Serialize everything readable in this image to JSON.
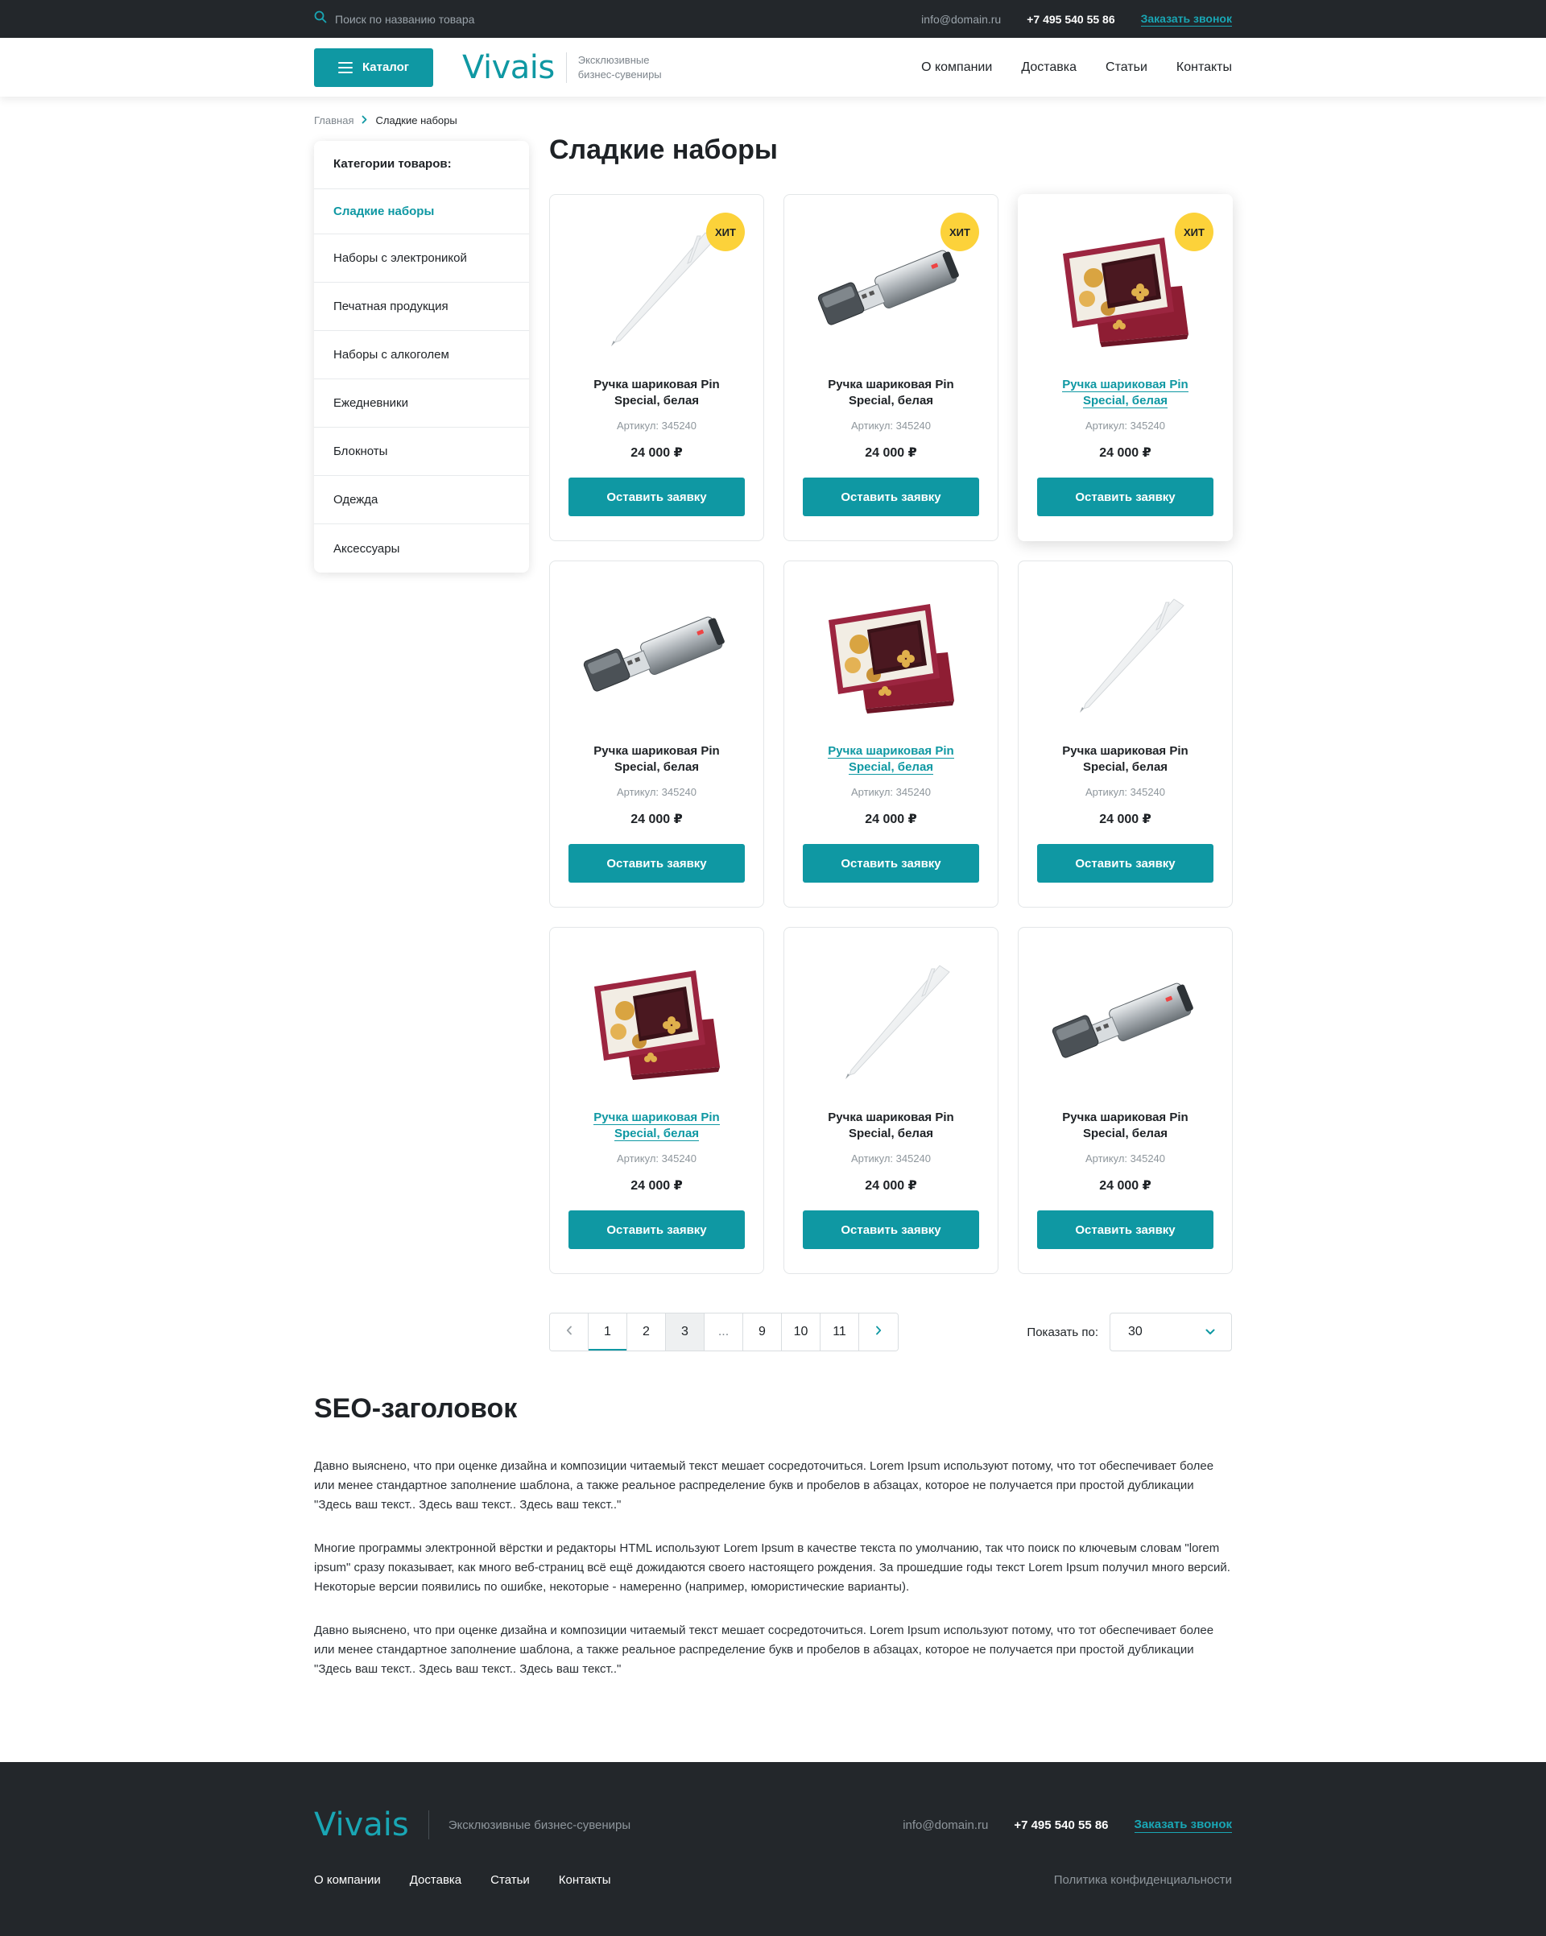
{
  "topbar": {
    "search_placeholder": "Поиск по названию товара",
    "email": "info@domain.ru",
    "phone": "+7 495 540 55 86",
    "callback": "Заказать звонок"
  },
  "header": {
    "catalog_label": "Каталог",
    "logo": "Vivais",
    "tagline": "Эксклюзивные бизнес-сувениры",
    "nav": [
      "О компании",
      "Доставка",
      "Статьи",
      "Контакты"
    ]
  },
  "breadcrumb": {
    "home": "Главная",
    "current": "Сладкие наборы"
  },
  "sidebar": {
    "title": "Категории товаров:",
    "items": [
      "Сладкие наборы",
      "Наборы с электроникой",
      "Печатная продукция",
      "Наборы с алкоголем",
      "Ежедневники",
      "Блокноты",
      "Одежда",
      "Аксессуары"
    ]
  },
  "page_title": "Сладкие наборы",
  "products": [
    {
      "image": "pen",
      "badge": "ХИТ",
      "name": "Ручка шариковая Pin Special, белая",
      "sku": "Артикул: 345240",
      "price": "24 000 ₽",
      "button": "Оставить заявку",
      "link": false,
      "hover": false
    },
    {
      "image": "usb",
      "badge": "ХИТ",
      "name": "Ручка шариковая Pin Special, белая",
      "sku": "Артикул: 345240",
      "price": "24 000 ₽",
      "button": "Оставить заявку",
      "link": false,
      "hover": false
    },
    {
      "image": "giftbox",
      "badge": "ХИТ",
      "name": "Ручка шариковая Pin Special, белая",
      "sku": "Артикул: 345240",
      "price": "24 000 ₽",
      "button": "Оставить заявку",
      "link": true,
      "hover": true
    },
    {
      "image": "usb",
      "badge": "",
      "name": "Ручка шариковая Pin Special, белая",
      "sku": "Артикул: 345240",
      "price": "24 000 ₽",
      "button": "Оставить заявку",
      "link": false,
      "hover": false
    },
    {
      "image": "giftbox",
      "badge": "",
      "name": "Ручка шариковая Pin Special, белая",
      "sku": "Артикул: 345240",
      "price": "24 000 ₽",
      "button": "Оставить заявку",
      "link": true,
      "hover": false
    },
    {
      "image": "pen",
      "badge": "",
      "name": "Ручка шариковая Pin Special, белая",
      "sku": "Артикул: 345240",
      "price": "24 000 ₽",
      "button": "Оставить заявку",
      "link": false,
      "hover": false
    },
    {
      "image": "giftbox",
      "badge": "",
      "name": "Ручка шариковая Pin Special, белая",
      "sku": "Артикул: 345240",
      "price": "24 000 ₽",
      "button": "Оставить заявку",
      "link": true,
      "hover": false
    },
    {
      "image": "pen",
      "badge": "",
      "name": "Ручка шариковая Pin Special, белая",
      "sku": "Артикул: 345240",
      "price": "24 000 ₽",
      "button": "Оставить заявку",
      "link": false,
      "hover": false
    },
    {
      "image": "usb",
      "badge": "",
      "name": "Ручка шариковая Pin Special, белая",
      "sku": "Артикул: 345240",
      "price": "24 000 ₽",
      "button": "Оставить заявку",
      "link": false,
      "hover": false
    }
  ],
  "pagination": {
    "pages": [
      "1",
      "2",
      "3",
      "...",
      "9",
      "10",
      "11"
    ],
    "active": "1",
    "current": "3",
    "per_page_label": "Показать по:",
    "per_page_value": "30"
  },
  "seo": {
    "title": "SEO-заголовок",
    "paragraphs": [
      "Давно выяснено, что при оценке дизайна и композиции читаемый текст мешает сосредоточиться. Lorem Ipsum используют потому, что тот обеспечивает более или менее стандартное заполнение шаблона, а также реальное распределение букв и пробелов в абзацах, которое не получается при простой дубликации \"Здесь ваш текст.. Здесь ваш текст.. Здесь ваш текст..\"",
      "Многие программы электронной вёрстки и редакторы HTML используют Lorem Ipsum в качестве текста по умолчанию, так что поиск по ключевым словам \"lorem ipsum\" сразу показывает, как много веб-страниц всё ещё дожидаются своего настоящего рождения. За прошедшие годы текст Lorem Ipsum получил много версий. Некоторые версии появились по ошибке, некоторые - намеренно (например, юмористические варианты).",
      "Давно выяснено, что при оценке дизайна и композиции читаемый текст мешает сосредоточиться. Lorem Ipsum используют потому, что тот обеспечивает более или менее стандартное заполнение шаблона, а также реальное распределение букв и пробелов в абзацах, которое не получается при простой дубликации \"Здесь ваш текст.. Здесь ваш текст.. Здесь ваш текст..\""
    ]
  },
  "footer": {
    "logo": "Vivais",
    "tagline": "Эксклюзивные бизнес-сувениры",
    "email": "info@domain.ru",
    "phone": "+7 495 540 55 86",
    "callback": "Заказать звонок",
    "nav": [
      "О компании",
      "Доставка",
      "Статьи",
      "Контакты"
    ],
    "policy": "Политика конфиденциальности"
  },
  "colors": {
    "accent": "#0f98a3",
    "dark": "#23272b",
    "badge": "#fcd23a"
  },
  "icons": {
    "search": "search-icon",
    "menu": "menu-icon",
    "breadcrumb_sep": "chevron-right-icon",
    "prev": "chevron-left-icon",
    "next": "chevron-right-icon",
    "select": "chevron-down-icon"
  }
}
